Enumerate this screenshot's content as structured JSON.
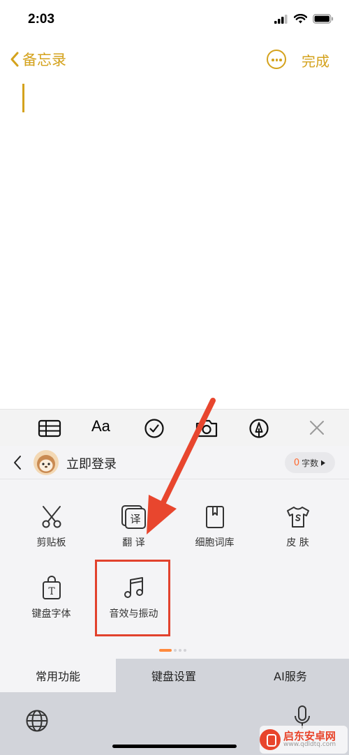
{
  "status_bar": {
    "time": "2:03"
  },
  "nav": {
    "back_label": "备忘录",
    "done_label": "完成"
  },
  "format_toolbar": {
    "text_format_label": "Aa"
  },
  "keyboard_header": {
    "login_label": "立即登录",
    "word_count": "0",
    "word_count_unit": "字数"
  },
  "tools": {
    "cut": "剪贴板",
    "translate": "翻 译",
    "translate_icon_char": "译",
    "lexicon": "细胞词库",
    "skin": "皮 肤",
    "font": "键盘字体",
    "font_icon_char": "T",
    "sound": "音效与振动"
  },
  "bottom_tabs": [
    "常用功能",
    "键盘设置",
    "AI服务"
  ],
  "watermark": {
    "name": "启东安卓网",
    "url": "www.qdldtq.com"
  },
  "colors": {
    "accent": "#d4a21c",
    "highlight": "#e2422d",
    "word_count": "#ff6a2f"
  }
}
